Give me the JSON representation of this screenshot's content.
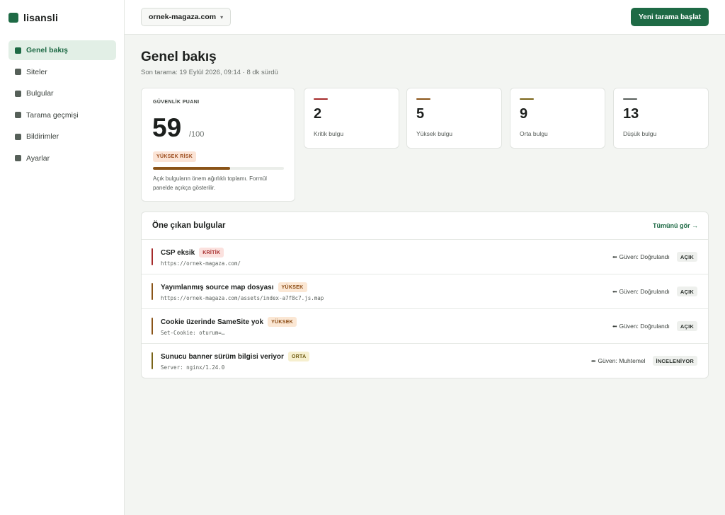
{
  "brand": {
    "name": "lisansli",
    "color": "#1e6a45"
  },
  "sidebar": {
    "items": [
      {
        "label": "Genel bakış",
        "active": true
      },
      {
        "label": "Siteler",
        "active": false
      },
      {
        "label": "Bulgular",
        "active": false
      },
      {
        "label": "Tarama geçmişi",
        "active": false
      },
      {
        "label": "Bildirimler",
        "active": false
      },
      {
        "label": "Ayarlar",
        "active": false
      }
    ]
  },
  "topbar": {
    "site_select": {
      "value": "ornek-magaza.com",
      "icon": "chevron-down-icon"
    },
    "new_scan_label": "Yeni tarama başlat"
  },
  "page": {
    "title": "Genel bakış",
    "subtitle": "Son tarama: 19 Eylül 2026, 09:14 · 8 dk sürdü"
  },
  "score": {
    "label": "GÜVENLİK PUANI",
    "value": "59",
    "max": "/100",
    "fraction": 0.59,
    "risk_label": "YÜKSEK RİSK",
    "note": "Açık bulguların önem ağırlıklı toplamı. Formül panelde açıkça gösterilir."
  },
  "stats": [
    {
      "value": "2",
      "label": "Kritik bulgu",
      "color": "#a52a2a"
    },
    {
      "value": "5",
      "label": "Yüksek bulgu",
      "color": "#8a5418"
    },
    {
      "value": "9",
      "label": "Orta bulgu",
      "color": "#7a6418"
    },
    {
      "value": "13",
      "label": "Düşük bulgu",
      "color": "#5a605c"
    }
  ],
  "findings": {
    "title": "Öne çıkan bulgular",
    "see_all": "Tümünü gör →",
    "rows": [
      {
        "name": "CSP eksik",
        "severity": "KRİTİK",
        "severity_bg": "#fbe1de",
        "severity_fg": "#a52a2a",
        "accent": "#a52a2a",
        "url": "https://ornek-magaza.com/",
        "confidence": "Güven: Doğrulandı",
        "status": "AÇIK"
      },
      {
        "name": "Yayımlanmış source map dosyası",
        "severity": "YÜKSEK",
        "severity_bg": "#fbe7d4",
        "severity_fg": "#8a4a12",
        "accent": "#8a5418",
        "url": "https://ornek-magaza.com/assets/index-a7f8c7.js.map",
        "confidence": "Güven: Doğrulandı",
        "status": "AÇIK"
      },
      {
        "name": "Cookie üzerinde SameSite yok",
        "severity": "YÜKSEK",
        "severity_bg": "#fbe7d4",
        "severity_fg": "#8a4a12",
        "accent": "#8a5418",
        "url": "Set-Cookie: oturum=…",
        "confidence": "Güven: Doğrulandı",
        "status": "AÇIK"
      },
      {
        "name": "Sunucu banner sürüm bilgisi veriyor",
        "severity": "ORTA",
        "severity_bg": "#f6efcf",
        "severity_fg": "#6e5a12",
        "accent": "#7a6418",
        "url": "Server: nginx/1.24.0",
        "confidence": "Güven: Muhtemel",
        "status": "İNCELENİYOR"
      }
    ]
  }
}
